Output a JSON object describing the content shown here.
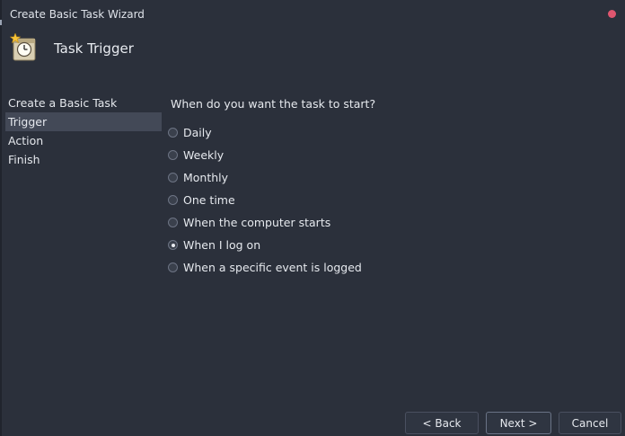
{
  "window": {
    "title": "Create Basic Task Wizard"
  },
  "header": {
    "title": "Task Trigger",
    "icon": "scheduled-task-icon"
  },
  "steps": [
    {
      "label": "Create a Basic Task",
      "active": false
    },
    {
      "label": "Trigger",
      "active": true
    },
    {
      "label": "Action",
      "active": false
    },
    {
      "label": "Finish",
      "active": false
    }
  ],
  "main": {
    "question": "When do you want the task to start?",
    "options": [
      {
        "label": "Daily",
        "checked": false
      },
      {
        "label": "Weekly",
        "checked": false
      },
      {
        "label": "Monthly",
        "checked": false
      },
      {
        "label": "One time",
        "checked": false
      },
      {
        "label": "When the computer starts",
        "checked": false
      },
      {
        "label": "When I log on",
        "checked": true
      },
      {
        "label": "When a specific event is logged",
        "checked": false
      }
    ]
  },
  "buttons": {
    "back": "< Back",
    "next": "Next >",
    "cancel": "Cancel"
  },
  "colors": {
    "background": "#2b303b",
    "active_step": "#434957",
    "close": "#e0566f"
  }
}
